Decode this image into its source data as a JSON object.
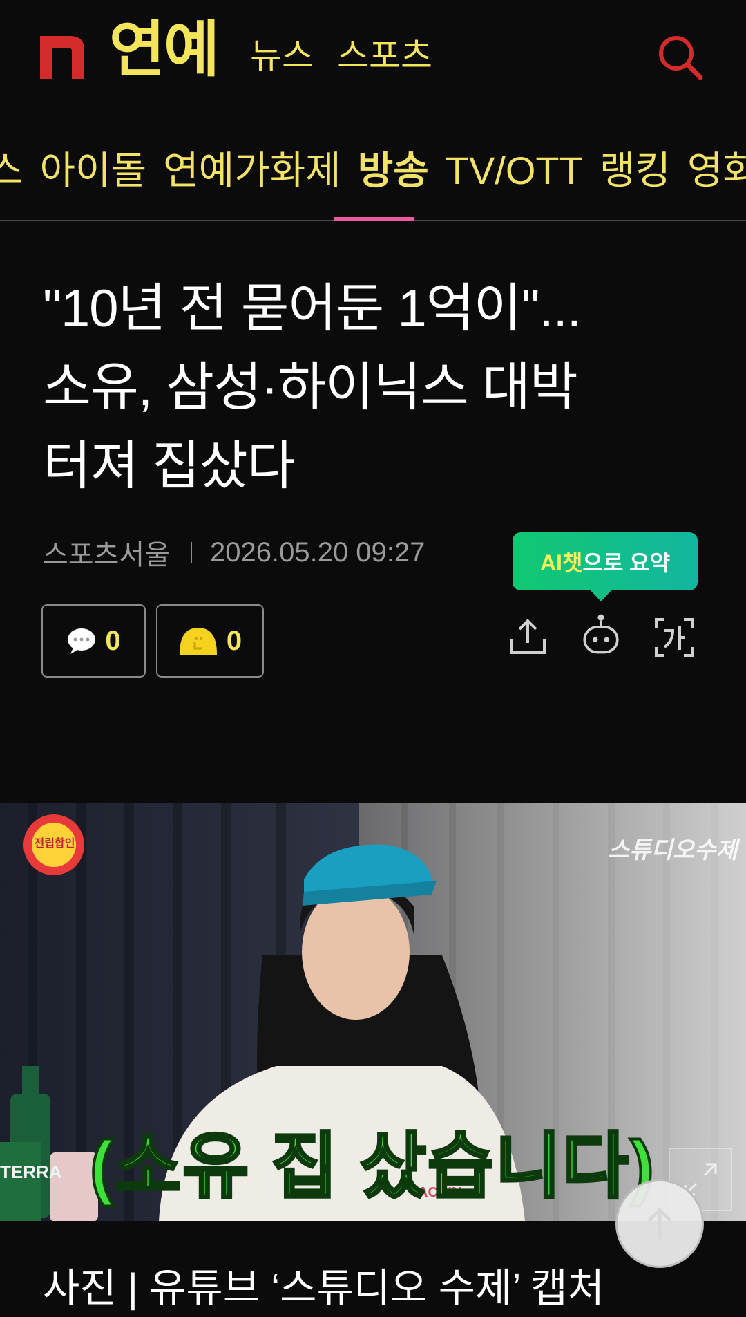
{
  "header": {
    "brand": "연예",
    "nav": [
      "뉴스",
      "스포츠"
    ]
  },
  "categories": {
    "items": [
      "스",
      "아이돌",
      "연예가화제",
      "방송",
      "TV/OTT",
      "랭킹",
      "영화"
    ],
    "active": "방송"
  },
  "article": {
    "title_lines": [
      "\"10년 전 묻어둔 1억이\"...",
      "소유, 삼성·하이닉스 대박",
      "터져 집샀다"
    ],
    "source": "스포츠서울",
    "datetime": "2026.05.20 09:27",
    "comment_count": "0",
    "like_count": "0"
  },
  "ai_summary": {
    "highlight": "AI챗",
    "rest": "으로 요약"
  },
  "photo": {
    "subtitle": "(소유 집 샀습니다)",
    "watermark": "스튜디오수제",
    "badge": "전립합인",
    "can_label": "TERRA",
    "shirt_text": "ACHIN"
  },
  "caption": "사진 | 유튜브 ‘스튜디오 수제’ 캡처",
  "colors": {
    "accent_yellow": "#f4e55a",
    "logo_red": "#d42b2b",
    "tab_underline": "#e95aa0",
    "ai_green": "#11c870"
  }
}
